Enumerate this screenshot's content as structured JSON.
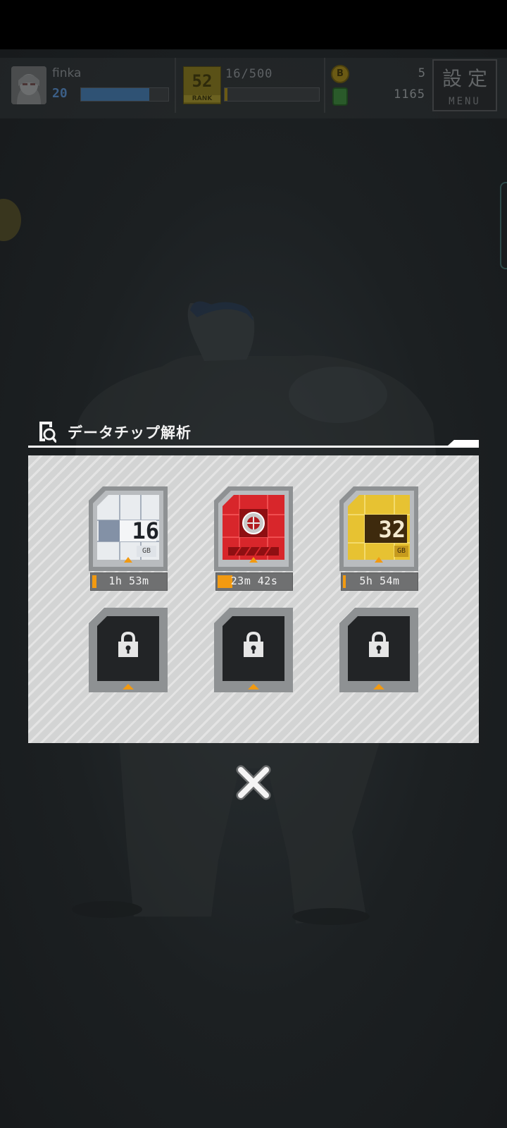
{
  "hud": {
    "player_name": "finka",
    "player_level": "20",
    "xp_progress": 0.78,
    "rank": "52",
    "rank_label": "RANK",
    "stamina": "16/500",
    "stamina_progress": 0.03,
    "coins": "5",
    "gems": "1165",
    "menu_kanji": "設定",
    "menu_label": "MENU"
  },
  "dialog": {
    "title": "データチップ解析",
    "slots": [
      {
        "type": "silver",
        "capacity": "16",
        "unit": "GB",
        "timer": "1h 53m",
        "progress": 0.06,
        "locked": false
      },
      {
        "type": "red",
        "capacity": "",
        "unit": "",
        "timer": "23m 42s",
        "progress": 0.2,
        "locked": false
      },
      {
        "type": "gold",
        "capacity": "32",
        "unit": "GB",
        "timer": "5h 54m",
        "progress": 0.02,
        "locked": false
      },
      {
        "type": "empty",
        "locked": true
      },
      {
        "type": "empty",
        "locked": true
      },
      {
        "type": "empty",
        "locked": true
      }
    ]
  },
  "colors": {
    "accent_orange": "#f29a11",
    "panel_bg": "#d3d4d4",
    "chip_red": "#d8262b",
    "chip_gold": "#d9a51c",
    "chip_silver": "#c9cdd2"
  }
}
